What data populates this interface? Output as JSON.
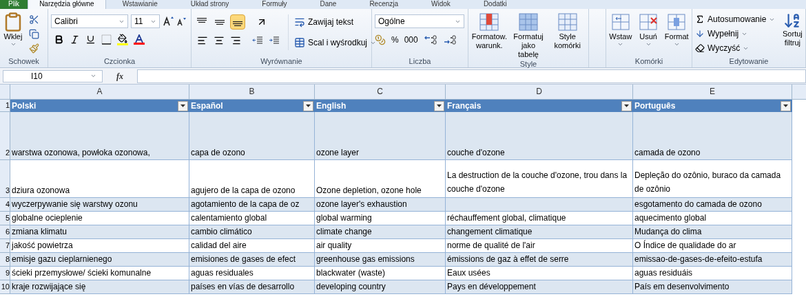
{
  "tabs": [
    {
      "label": "Plik",
      "selected": false
    },
    {
      "label": "Narzędzia główne",
      "selected": true
    },
    {
      "label": "Wstawianie",
      "selected": false
    },
    {
      "label": "Układ strony",
      "selected": false
    },
    {
      "label": "Formuły",
      "selected": false
    },
    {
      "label": "Dane",
      "selected": false
    },
    {
      "label": "Recenzja",
      "selected": false
    },
    {
      "label": "Widok",
      "selected": false
    },
    {
      "label": "Dodatki",
      "selected": false
    }
  ],
  "ribbon": {
    "clipboard": {
      "label": "Schowek",
      "paste": "Wklej"
    },
    "font": {
      "label": "Czcionka",
      "font_name": "Calibri",
      "font_size": "11"
    },
    "alignment": {
      "label": "Wyrównanie",
      "vertical": [
        {
          "selected": false
        },
        {
          "selected": false
        },
        {
          "selected": true
        }
      ],
      "wrap_text": "Zawijaj tekst",
      "merge": "Scal i wyśrodkuj"
    },
    "number": {
      "label": "Liczba",
      "format": "Ogólne",
      "percent": "%",
      "thousands": "000"
    },
    "styles": {
      "label": "Style",
      "buttons": [
        "Formatow. warunk.",
        "Formatuj jako tabelę",
        "Style komórki"
      ]
    },
    "cells": {
      "label": "Komórki",
      "buttons": [
        "Wstaw",
        "Usuń",
        "Format"
      ]
    },
    "editing": {
      "label": "Edytowanie",
      "items": [
        "Autosumowanie",
        "Wypełnij",
        "Wyczyść"
      ],
      "sort": "Sortuj filtruj"
    }
  },
  "formula_bar": {
    "cell_ref": "I10",
    "fx": "fx"
  },
  "sheet": {
    "columns": [
      "A",
      "B",
      "C",
      "D",
      "E"
    ],
    "header_row": {
      "number": "1",
      "cells": [
        "Polski",
        "Español",
        "English",
        "Français",
        "Português"
      ]
    },
    "rows": [
      {
        "number": "2",
        "cells": [
          "warstwa ozonowa, powłoka ozonowa,",
          "capa de ozono",
          "ozone layer",
          "couche d'ozone",
          "camada de ozono"
        ]
      },
      {
        "number": "3",
        "cells": [
          "dziura ozonowa",
          "agujero de la capa de ozono",
          "Ozone depletion, ozone hole",
          "La destruction de la couche d'ozone, trou dans la couche d'ozone",
          "Depleção do ozônio, buraco da camada de ozônio"
        ]
      },
      {
        "number": "4",
        "cells": [
          "wyczerpywanie się warstwy ozonu",
          "agotamiento de la capa de oz",
          "ozone layer's exhaustion",
          "",
          "esgotamento do camada de ozono"
        ]
      },
      {
        "number": "5",
        "cells": [
          "globalne ocieplenie",
          "calentamiento global",
          "global warming",
          "réchauffement global, climatique",
          "aquecimento global"
        ]
      },
      {
        "number": "6",
        "cells": [
          "zmiana klimatu",
          "cambio climático",
          "climate change",
          "changement climatique",
          "Mudança do clima"
        ]
      },
      {
        "number": "7",
        "cells": [
          "jakość powietrza",
          "calidad del aire",
          "air quality",
          "norme de qualité de l'air",
          "O Índice de qualidade do ar"
        ]
      },
      {
        "number": "8",
        "cells": [
          "emisje gazu cieplarnienego",
          "emisiones de gases de efect",
          "greenhouse gas emissions",
          "émissions de gaz à effet de serre",
          "emissao-de-gases-de-efeito-estufa"
        ]
      },
      {
        "number": "9",
        "cells": [
          "ścieki przemysłowe/ ścieki komunalne",
          "aguas residuales",
          "blackwater (waste)",
          "Eaux usées",
          "aguas residuáis"
        ]
      },
      {
        "number": "10",
        "cells": [
          "kraje rozwijające się",
          "países en vías de desarrollo",
          "developing country",
          "Pays en développement",
          "País em desenvolvimento"
        ]
      }
    ]
  }
}
